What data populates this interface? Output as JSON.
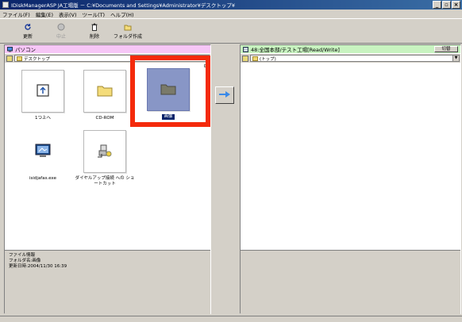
{
  "window": {
    "title": "IDiskManagerASP JA工場版 － C:¥Documents and Settings¥Administrator¥デスクトップ¥",
    "btn_min": "_",
    "btn_max": "▫",
    "btn_close": "×"
  },
  "menu": [
    "ファイル(F)",
    "編集(E)",
    "表示(V)",
    "ツール(T)",
    "ヘルプ(H)"
  ],
  "toolbar": {
    "refresh_label": "更新",
    "stop_label": "中止",
    "delete_label": "削除",
    "new_folder_label": "フォルダ作成"
  },
  "left": {
    "header_title": "パソコン",
    "path": "デスクトップ",
    "items": [
      {
        "label": "1つ上へ",
        "icon": "up-folder-icon"
      },
      {
        "label": "CD-ROM",
        "icon": "folder-icon"
      },
      {
        "label": "画像",
        "icon": "folder-icon",
        "selected": true
      },
      {
        "label": "isidjafas.exe",
        "icon": "application-icon"
      },
      {
        "label": "ダイヤルアップ接続 への ショートカット",
        "icon": "shortcut-icon"
      }
    ],
    "info": {
      "heading": "ファイル情報",
      "folder_name": "フォルダ名:画像",
      "updated": "更新日時:2004/11/30 16:39"
    }
  },
  "right": {
    "header_title": "48:全国本部/テスト工場[Read/Write]",
    "toggle_label": "切替",
    "path": "(トップ)"
  },
  "colors": {
    "left_header": "#f6c6f6",
    "right_header": "#c8f3c0",
    "highlight": "#f42a0c",
    "selection": "#8896c6"
  }
}
